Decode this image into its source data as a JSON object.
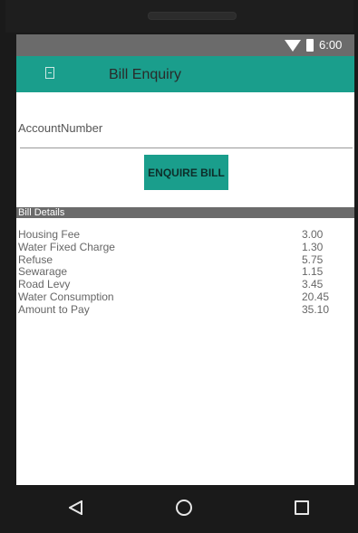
{
  "status_bar": {
    "time": "6:00"
  },
  "app_bar": {
    "title": "Bill Enquiry",
    "icon": "document-icon"
  },
  "form": {
    "account_label": "AccountNumber",
    "account_value": "",
    "enquire_button": "ENQUIRE BILL"
  },
  "bill_details": {
    "header": "Bill Details",
    "items": [
      {
        "label": "Housing Fee",
        "value": "3.00"
      },
      {
        "label": "Water Fixed Charge",
        "value": "1.30"
      },
      {
        "label": "Refuse",
        "value": "5.75"
      },
      {
        "label": "Sewarage",
        "value": "1.15"
      },
      {
        "label": "Road Levy",
        "value": "3.45"
      },
      {
        "label": "Water Consumption",
        "value": "20.45"
      },
      {
        "label": "Amount to Pay",
        "value": "35.10"
      }
    ]
  },
  "colors": {
    "accent": "#1a9e8c",
    "status_bar": "#6b6b6b"
  },
  "nav_icons": [
    "back-icon",
    "home-icon",
    "recent-apps-icon"
  ]
}
